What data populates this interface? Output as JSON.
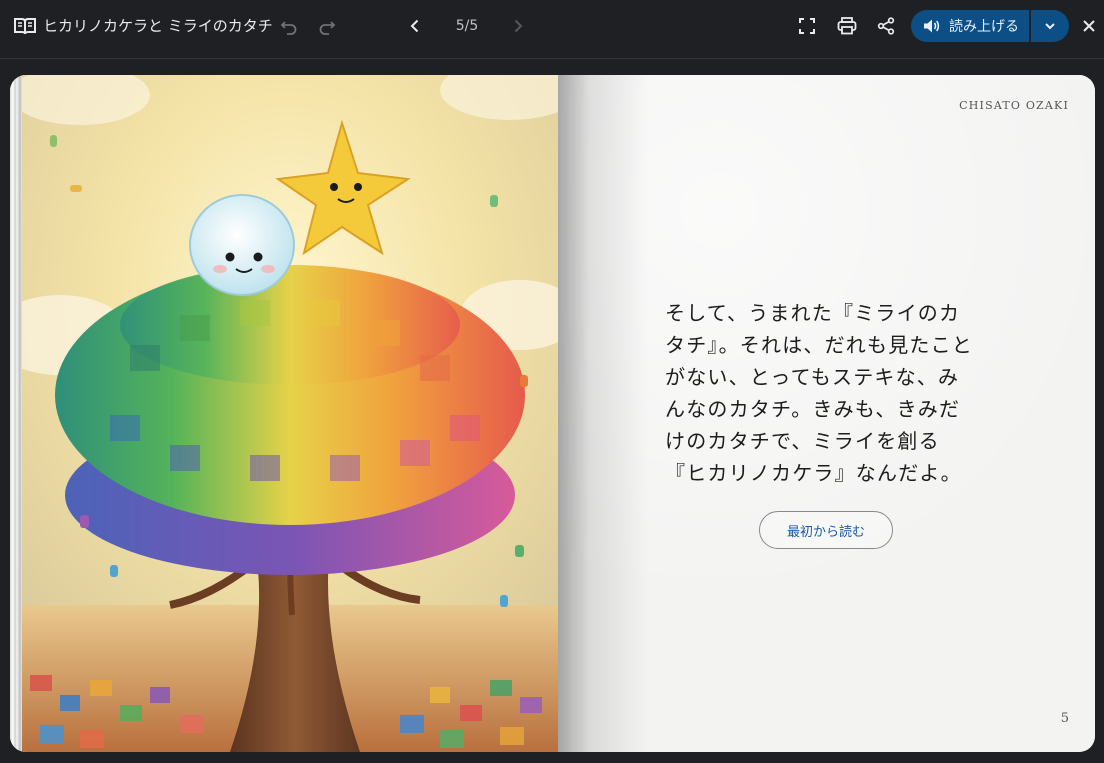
{
  "header": {
    "title": "ヒカリノカケラと ミライのカタチ",
    "page_indicator": "5/5",
    "read_aloud_label": "読み上げる"
  },
  "icons": {
    "book": "book-open-icon",
    "undo": "undo-icon",
    "redo": "redo-icon",
    "prev": "chevron-left-icon",
    "next": "chevron-right-icon",
    "fullscreen": "fullscreen-icon",
    "print": "printer-icon",
    "share": "share-icon",
    "speaker": "speaker-icon",
    "dropdown": "chevron-down-icon",
    "close": "close-icon"
  },
  "page": {
    "author": "CHISATO OZAKI",
    "text_lines": [
      "そして、うまれた『ミライのカ",
      "タチ』。それは、だれも見たこと",
      "がない、とってもステキな、み",
      "んなのカタチ。きみも、きみだ",
      "けのカタチで、ミライを創る",
      "『ヒカリノカケラ』なんだよ。"
    ],
    "restart_label": "最初から読む",
    "number": "5"
  },
  "colors": {
    "toolbar_bg": "#1f2023",
    "accent": "#0b4f86",
    "link": "#1b5aa8"
  }
}
